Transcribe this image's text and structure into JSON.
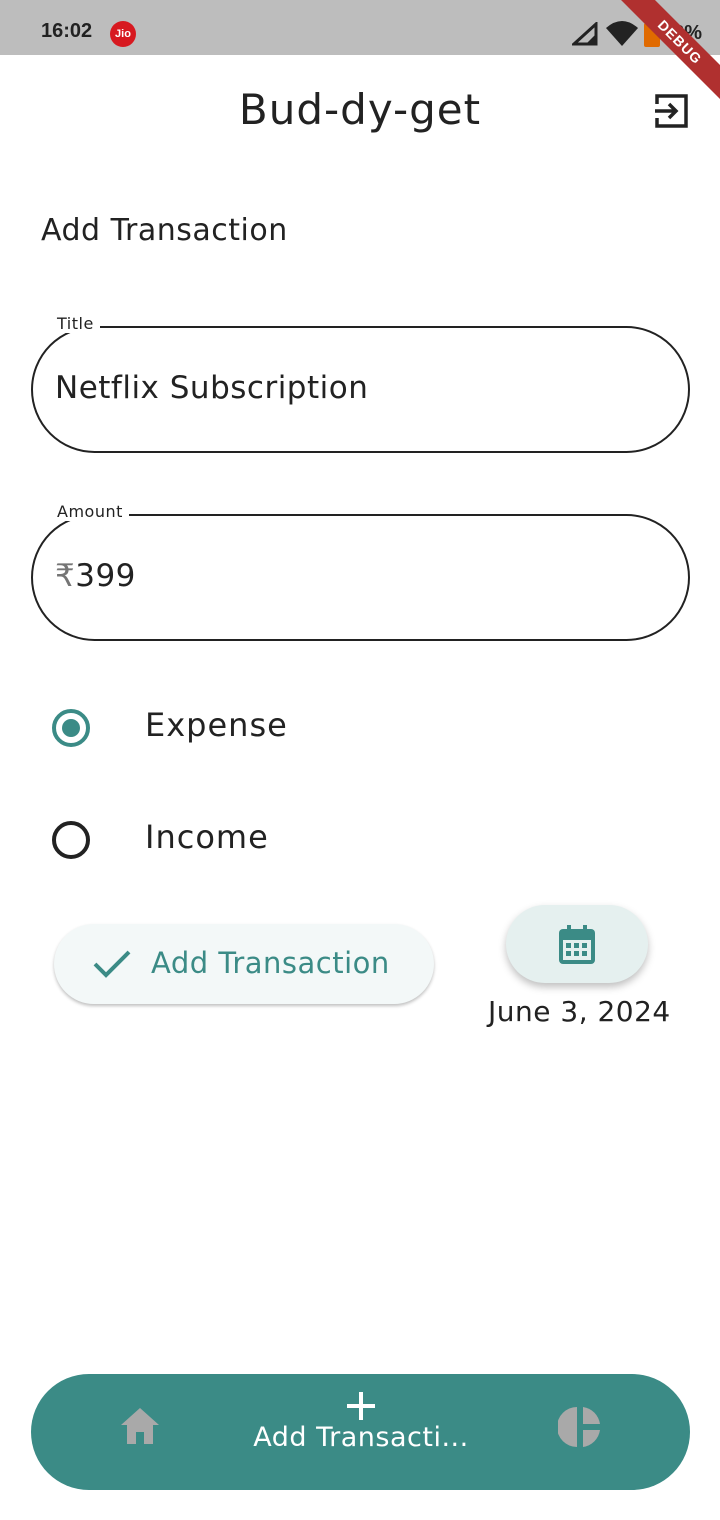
{
  "status_bar": {
    "time": "16:02",
    "carrier_badge": "Jio",
    "battery": "82%",
    "debug_label": "DEBUG"
  },
  "header": {
    "title": "Bud-dy-get",
    "logout_icon": "logout-icon"
  },
  "form": {
    "section_title": "Add Transaction",
    "title_field": {
      "label": "Title",
      "value": "Netflix Subscription"
    },
    "amount_field": {
      "label": "Amount",
      "prefix": "₹",
      "value": "399"
    },
    "type_options": [
      {
        "label": "Expense",
        "selected": true
      },
      {
        "label": "Income",
        "selected": false
      }
    ],
    "submit_label": "Add Transaction",
    "date_value": "June 3, 2024"
  },
  "bottom_nav": {
    "items": [
      {
        "icon": "home-icon",
        "label": ""
      },
      {
        "icon": "plus-icon",
        "label": "Add Transacti..."
      },
      {
        "icon": "pie-chart-icon",
        "label": ""
      }
    ]
  },
  "colors": {
    "accent": "#3b8b86",
    "status_bar": "#bdbdbd",
    "inactive_nav_icon": "#a9a9a9"
  }
}
